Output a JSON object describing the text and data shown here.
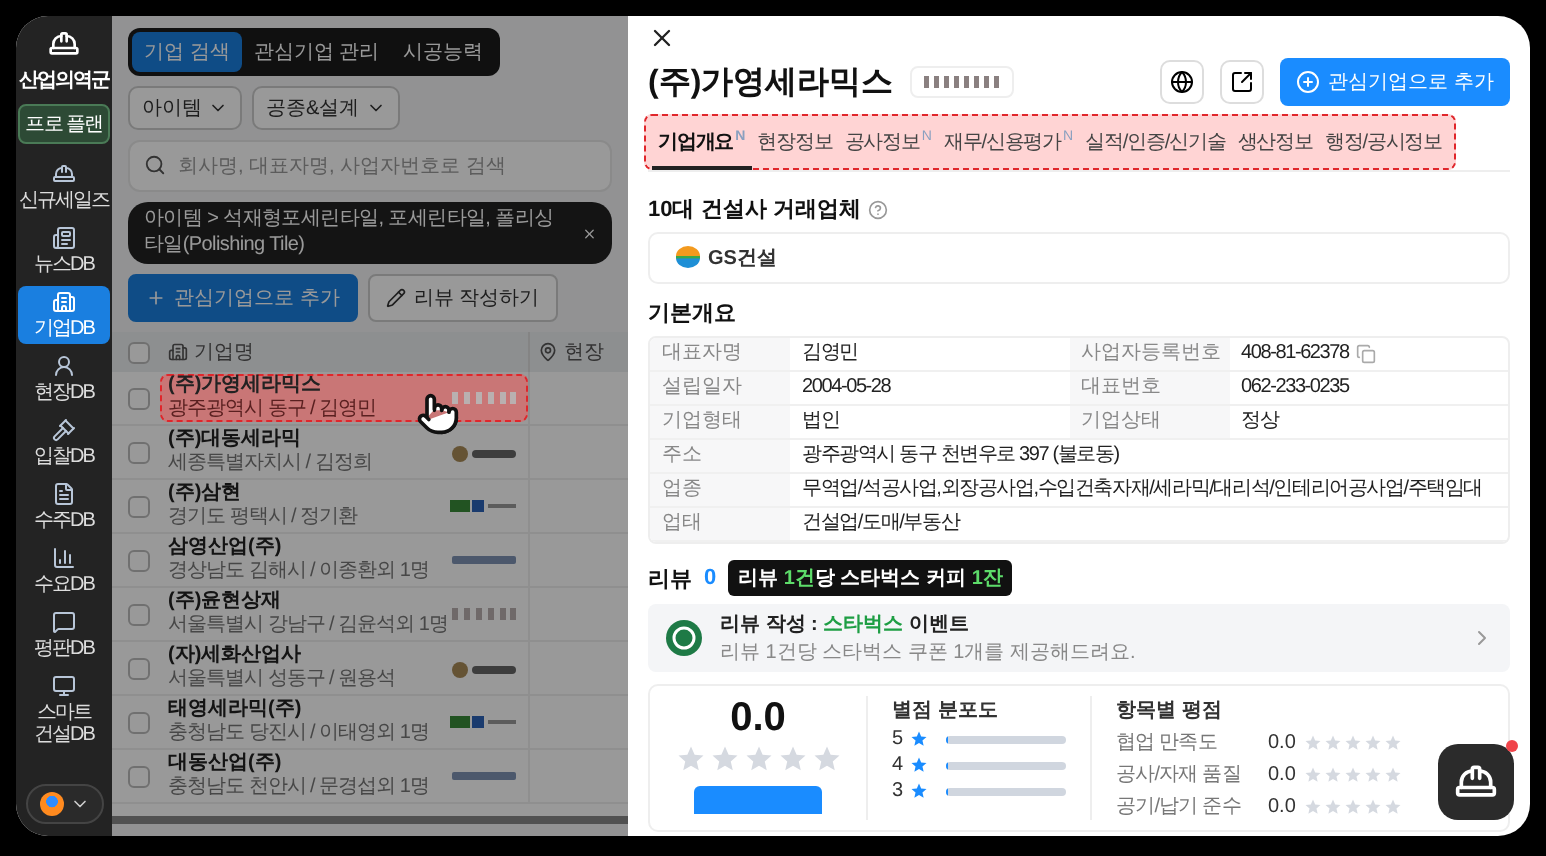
{
  "sidebar": {
    "brand": "산업의역군",
    "plan_button": "프로 플랜",
    "items": [
      {
        "label": "신규세일즈",
        "selected": false
      },
      {
        "label": "뉴스DB",
        "selected": false
      },
      {
        "label": "기업DB",
        "selected": true
      },
      {
        "label": "현장DB",
        "selected": false
      },
      {
        "label": "입찰DB",
        "selected": false
      },
      {
        "label": "수주DB",
        "selected": false
      },
      {
        "label": "수요DB",
        "selected": false
      },
      {
        "label": "평판DB",
        "selected": false
      },
      {
        "label": "스마트 건설DB",
        "selected": false
      }
    ]
  },
  "list": {
    "tabs": [
      {
        "label": "기업 검색",
        "selected": true
      },
      {
        "label": "관심기업 관리",
        "selected": false
      },
      {
        "label": "시공능력",
        "selected": false
      }
    ],
    "filters": [
      "아이템",
      "공종&설계"
    ],
    "search": {
      "placeholder": "회사명, 대표자명, 사업자번호로 검색"
    },
    "filter_chip": "아이템 > 석재형포세린타일, 포세린타일, 폴리싱타일(Polishing Tile)",
    "actions": [
      {
        "label": "관심기업으로 추가",
        "kind": "primary"
      },
      {
        "label": "리뷰 작성하기",
        "kind": "secondary"
      }
    ],
    "all_checked": false,
    "columns": [
      "기업명",
      "현장"
    ],
    "rows": [
      {
        "name": "(주)가영세라믹스",
        "info": "광주광역시 동구 / 김영민",
        "checked": false,
        "highlighted": true
      },
      {
        "name": "(주)대동세라믹",
        "info": "세종특별자치시 / 김정희",
        "checked": false,
        "highlighted": false
      },
      {
        "name": "(주)삼현",
        "info": "경기도 평택시 / 정기환",
        "checked": false,
        "highlighted": false
      },
      {
        "name": "삼영산업(주)",
        "info": "경상남도 김해시 / 이종환외 1명",
        "checked": false,
        "highlighted": false
      },
      {
        "name": "(주)윤현상재",
        "info": "서울특별시 강남구 / 김윤석외 1명",
        "checked": false,
        "highlighted": false
      },
      {
        "name": "(자)세화산업사",
        "info": "서울특별시 성동구 / 원용석",
        "checked": false,
        "highlighted": false
      },
      {
        "name": "태영세라믹(주)",
        "info": "충청남도 당진시 / 이태영외 1명",
        "checked": false,
        "highlighted": false
      },
      {
        "name": "대동산업(주)",
        "info": "충청남도 천안시 / 문경섭외 1명",
        "checked": false,
        "highlighted": false
      }
    ]
  },
  "panel": {
    "title": "(주)가영세라믹스",
    "add_button": "관심기업으로 추가",
    "tabs_highlighted": true,
    "tabs": [
      {
        "label": "기업개요",
        "selected": true,
        "badge": "N"
      },
      {
        "label": "현장정보",
        "selected": false
      },
      {
        "label": "공사정보",
        "selected": false,
        "badge": "N"
      },
      {
        "label": "재무/신용평가",
        "selected": false,
        "badge": "N"
      },
      {
        "label": "실적/인증/신기술",
        "selected": false
      },
      {
        "label": "생산정보",
        "selected": false
      },
      {
        "label": "행정/공시정보",
        "selected": false
      }
    ],
    "partners": {
      "title": "10대 건설사 거래업체",
      "items": [
        "GS건설"
      ]
    },
    "overview": {
      "title": "기본개요",
      "rows": [
        [
          {
            "label": "대표자명",
            "value": "김영민"
          },
          {
            "label": "사업자등록번호",
            "value": "408-81-62378",
            "copy": true
          }
        ],
        [
          {
            "label": "설립일자",
            "value": "2004-05-28"
          },
          {
            "label": "대표번호",
            "value": "062-233-0235"
          }
        ],
        [
          {
            "label": "기업형태",
            "value": "법인"
          },
          {
            "label": "기업상태",
            "value": "정상"
          }
        ],
        [
          {
            "label": "주소",
            "value": "광주광역시 동구 천변우로 397 (불로동)"
          }
        ],
        [
          {
            "label": "업종",
            "value": "무역업/석공사업,외장공사업,수입건축자재/세라믹/대리석/인테리어공사업/주택임대"
          }
        ],
        [
          {
            "label": "업태",
            "value": "건설업/도매/부동산"
          }
        ]
      ]
    },
    "review": {
      "title": "리뷰",
      "count": "0",
      "badge": "리뷰 **1건**당 스타벅스 커피 **1잔**",
      "event_title": "리뷰 작성 : **스타벅스** 이벤트",
      "event_text": "리뷰 1건당 스타벅스 쿠폰 1개를 제공해드려요.",
      "score": "0.0",
      "stars": 0,
      "distribution_title": "별점 분포도",
      "distribution": [
        {
          "label": "5",
          "level": 0
        },
        {
          "label": "4",
          "level": 0
        },
        {
          "label": "3",
          "level": 0
        }
      ],
      "criteria_title": "항목별 평점",
      "criteria": [
        {
          "label": "협업 만족도",
          "score": "0.0",
          "stars": 0
        },
        {
          "label": "공사/자재 품질",
          "score": "0.0",
          "stars": 0
        },
        {
          "label": "공기/납기 준수",
          "score": "0.0",
          "stars": 0
        }
      ]
    }
  }
}
